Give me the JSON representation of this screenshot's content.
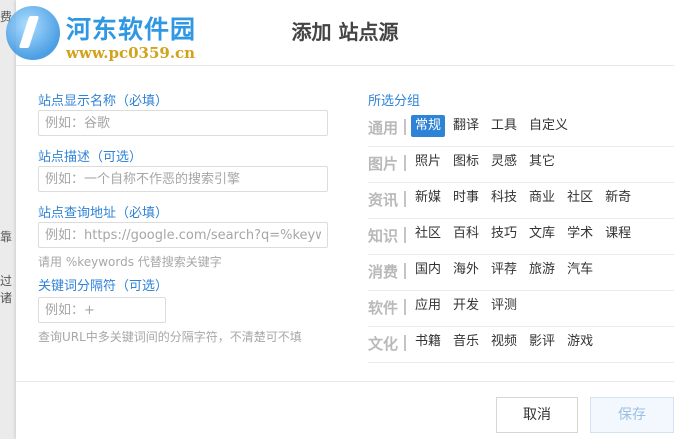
{
  "background": {
    "fragments": [
      "费",
      "靠",
      "过诸"
    ]
  },
  "watermark": {
    "name": "河东软件园",
    "url": "www.pc0359.cn"
  },
  "dialog": {
    "title": "添加 站点源",
    "form": {
      "name_label": "站点显示名称（必填）",
      "name_placeholder": "例如：谷歌",
      "desc_label": "站点描述（可选）",
      "desc_placeholder": "例如：一个自称不作恶的搜索引擎",
      "url_label": "站点查询地址（必填）",
      "url_placeholder": "例如：https://google.com/search?q=%keywords%",
      "url_hint": "请用 %keywords 代替搜索关键字",
      "sep_label": "关键词分隔符（可选）",
      "sep_placeholder": "例如：+",
      "sep_hint": "查询URL中多关键词间的分隔字符，不清楚可不填"
    },
    "groups": {
      "title": "所选分组",
      "rows": [
        {
          "category": "通用",
          "items": [
            "常规",
            "翻译",
            "工具",
            "自定义"
          ],
          "selected": "常规"
        },
        {
          "category": "图片",
          "items": [
            "照片",
            "图标",
            "灵感",
            "其它"
          ]
        },
        {
          "category": "资讯",
          "items": [
            "新媒",
            "时事",
            "科技",
            "商业",
            "社区",
            "新奇"
          ]
        },
        {
          "category": "知识",
          "items": [
            "社区",
            "百科",
            "技巧",
            "文库",
            "学术",
            "课程"
          ]
        },
        {
          "category": "消费",
          "items": [
            "国内",
            "海外",
            "评荐",
            "旅游",
            "汽车"
          ]
        },
        {
          "category": "软件",
          "items": [
            "应用",
            "开发",
            "评测"
          ]
        },
        {
          "category": "文化",
          "items": [
            "书籍",
            "音乐",
            "视频",
            "影评",
            "游戏"
          ]
        }
      ]
    },
    "buttons": {
      "cancel": "取消",
      "save": "保存"
    }
  },
  "colors": {
    "accent": "#2f83d6",
    "logo_blue": "#2f97e4",
    "logo_gold": "#d2a21c"
  }
}
